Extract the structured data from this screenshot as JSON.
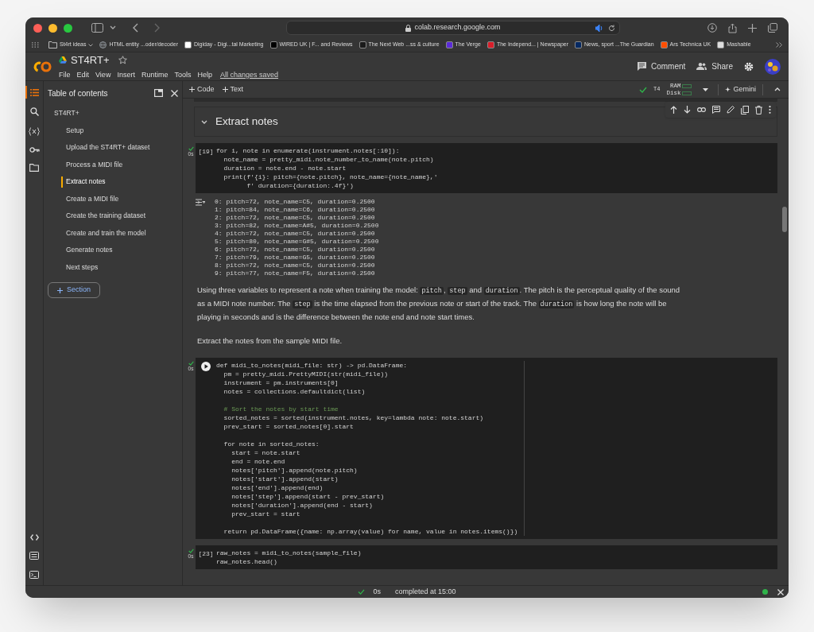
{
  "browser": {
    "url": "colab.research.google.com",
    "bookmarks": [
      {
        "label": "St4rt ideas",
        "kind": "folder"
      },
      {
        "label": "HTML entity ...oder/decoder",
        "kind": "globe"
      },
      {
        "label": "Digiday - Digi...tal Marketing",
        "kind": "site",
        "color": "#ffffff"
      },
      {
        "label": "WIRED UK | F... and Reviews",
        "kind": "site",
        "color": "#000000"
      },
      {
        "label": "The Next Web ...ss & culture",
        "kind": "site",
        "color": "#1a1a1a"
      },
      {
        "label": "The Verge",
        "kind": "site",
        "color": "#5b2bd8"
      },
      {
        "label": "The Independ... | Newspaper",
        "kind": "site",
        "color": "#d81e2a"
      },
      {
        "label": "News, sport ...The Guardian",
        "kind": "site",
        "color": "#052962"
      },
      {
        "label": "Ars Technica UK",
        "kind": "site",
        "color": "#ff4e00"
      },
      {
        "label": "Mashable",
        "kind": "site",
        "color": "#dddddd"
      }
    ]
  },
  "header": {
    "title": "ST4RT+",
    "menu": [
      "File",
      "Edit",
      "View",
      "Insert",
      "Runtime",
      "Tools",
      "Help"
    ],
    "save_status": "All changes saved",
    "actions": [
      "Comment",
      "Share"
    ]
  },
  "toolbar": {
    "add_buttons": [
      "Code",
      "Text"
    ],
    "runtime": "T4",
    "ram_label": "RAM",
    "disk_label": "Disk",
    "assistant": "Gemini"
  },
  "sidebar": {
    "title": "Table of contents",
    "items": [
      {
        "label": "ST4RT+",
        "selected": false,
        "children": [
          {
            "label": "Setup",
            "selected": false
          },
          {
            "label": "Upload the ST4RT+ dataset",
            "selected": false
          },
          {
            "label": "Process a MIDI file",
            "selected": false
          },
          {
            "label": "Extract notes",
            "selected": true
          },
          {
            "label": "Create a MIDI file",
            "selected": false
          },
          {
            "label": "Create the training dataset",
            "selected": false
          },
          {
            "label": "Create and train the model",
            "selected": false
          },
          {
            "label": "Generate notes",
            "selected": false
          },
          {
            "label": "Next steps",
            "selected": false
          }
        ]
      }
    ],
    "add_section": "Section"
  },
  "cells": [
    {
      "kind": "heading",
      "text": "Extract notes"
    },
    {
      "kind": "code",
      "prompt": "[19]",
      "time": "0s",
      "lines": [
        {
          "text": "for i, note in enumerate(instrument.notes[:10]):"
        },
        {
          "text": "  note_name = pretty_midi.note_number_to_name(note.pitch)"
        },
        {
          "text": "  duration = note.end - note.start"
        },
        {
          "text": "  print(f'{i}: pitch={note.pitch}, note_name={note_name},'"
        },
        {
          "text": "        f' duration={duration:.4f}')"
        }
      ],
      "output": [
        "0: pitch=72, note_name=C5, duration=0.2500",
        "1: pitch=84, note_name=C6, duration=0.2500",
        "2: pitch=72, note_name=C5, duration=0.2500",
        "3: pitch=82, note_name=A#5, duration=0.2500",
        "4: pitch=72, note_name=C5, duration=0.2500",
        "5: pitch=80, note_name=G#5, duration=0.2500",
        "6: pitch=72, note_name=C5, duration=0.2500",
        "7: pitch=79, note_name=G5, duration=0.2500",
        "8: pitch=72, note_name=C5, duration=0.2500",
        "9: pitch=77, note_name=F5, duration=0.2500"
      ]
    },
    {
      "kind": "text",
      "paragraphs": [
        [
          {
            "text": "Using three variables to represent a note when training the model: "
          },
          {
            "text": "pitch",
            "code": true
          },
          {
            "text": ", "
          },
          {
            "text": "step",
            "code": true
          },
          {
            "text": " and "
          },
          {
            "text": "duration",
            "code": true
          },
          {
            "text": ". The pitch is the perceptual quality of the sound as a MIDI note number. The "
          },
          {
            "text": "step",
            "code": true
          },
          {
            "text": " is the time elapsed from the previous note or start of the track. The "
          },
          {
            "text": "duration",
            "code": true
          },
          {
            "text": " is how long the note will be playing in seconds and is the difference between the note end and note start times."
          }
        ],
        [
          {
            "text": "Extract the notes from the sample MIDI file."
          }
        ]
      ]
    },
    {
      "kind": "code",
      "time": "0s",
      "lines": [
        {
          "text": "def midi_to_notes(midi_file: str) -> pd.DataFrame:"
        },
        {
          "text": "  pm = pretty_midi.PrettyMIDI(str(midi_file))"
        },
        {
          "text": "  instrument = pm.instruments[0]"
        },
        {
          "text": "  notes = collections.defaultdict(list)"
        },
        {
          "kind": "blank"
        },
        {
          "text": "  # Sort the notes by start time",
          "kind": "comment"
        },
        {
          "text": "  sorted_notes = sorted(instrument.notes, key=lambda note: note.start)"
        },
        {
          "text": "  prev_start = sorted_notes[0].start"
        },
        {
          "kind": "blank"
        },
        {
          "text": "  for note in sorted_notes:"
        },
        {
          "text": "    start = note.start"
        },
        {
          "text": "    end = note.end"
        },
        {
          "text": "    notes['pitch'].append(note.pitch)"
        },
        {
          "text": "    notes['start'].append(start)"
        },
        {
          "text": "    notes['end'].append(end)"
        },
        {
          "text": "    notes['step'].append(start - prev_start)"
        },
        {
          "text": "    notes['duration'].append(end - start)"
        },
        {
          "text": "    prev_start = start"
        },
        {
          "kind": "blank"
        },
        {
          "text": "  return pd.DataFrame({name: np.array(value) for name, value in notes.items()})"
        }
      ]
    },
    {
      "kind": "code",
      "prompt": "[23]",
      "time": "0s",
      "lines": [
        {
          "text": "raw_notes = midi_to_notes(sample_file)"
        },
        {
          "text": "raw_notes.head()"
        }
      ]
    }
  ],
  "status_bar": {
    "time": "0s",
    "text": "completed at 15:00"
  }
}
